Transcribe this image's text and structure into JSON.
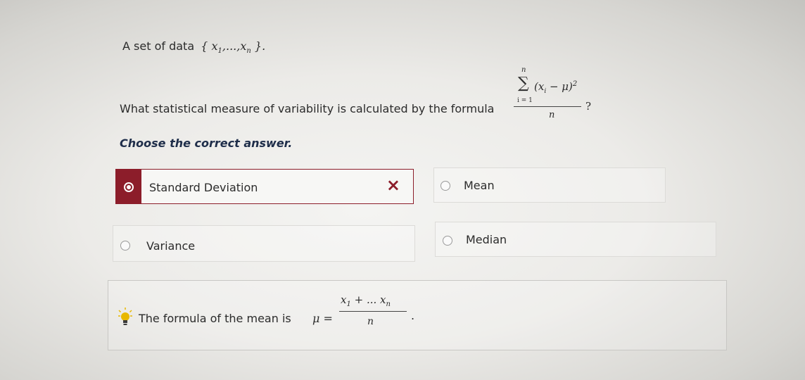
{
  "question": {
    "intro_label": "A set of data",
    "data_set": {
      "open": "{",
      "x": "x",
      "sub1": "1",
      "mid": ",...,",
      "x2": "x",
      "subn": "n",
      "close": "}",
      "period": "."
    },
    "prompt": "What statistical measure of variability is calculated by the formula",
    "formula": {
      "sigma": "∑",
      "sigma_upper": "n",
      "sigma_lower": "i = 1",
      "numerator": "(x",
      "numerator_sub": "i",
      "numerator_rest": " − μ)",
      "numerator_exp": "2",
      "denominator": "n",
      "question_mark": "?"
    }
  },
  "instruction": "Choose the correct answer.",
  "options": [
    {
      "label": "Standard Deviation",
      "selected": true,
      "marked_wrong": true,
      "wrong_mark": "×"
    },
    {
      "label": "Mean",
      "selected": false
    },
    {
      "label": "Variance",
      "selected": false
    },
    {
      "label": "Median",
      "selected": false
    }
  ],
  "hint": {
    "icon": "lightbulb-icon",
    "text": "The formula of the mean is",
    "mu": "μ =",
    "numerator_x1": "x",
    "numerator_sub1": "1",
    "numerator_mid": " + ... x",
    "numerator_subn": "n",
    "denominator": "n",
    "trailing": "."
  },
  "colors": {
    "selected": "#8c1d2a",
    "instruction_text": "#1f2e4a",
    "bulb": "#e8b800"
  }
}
